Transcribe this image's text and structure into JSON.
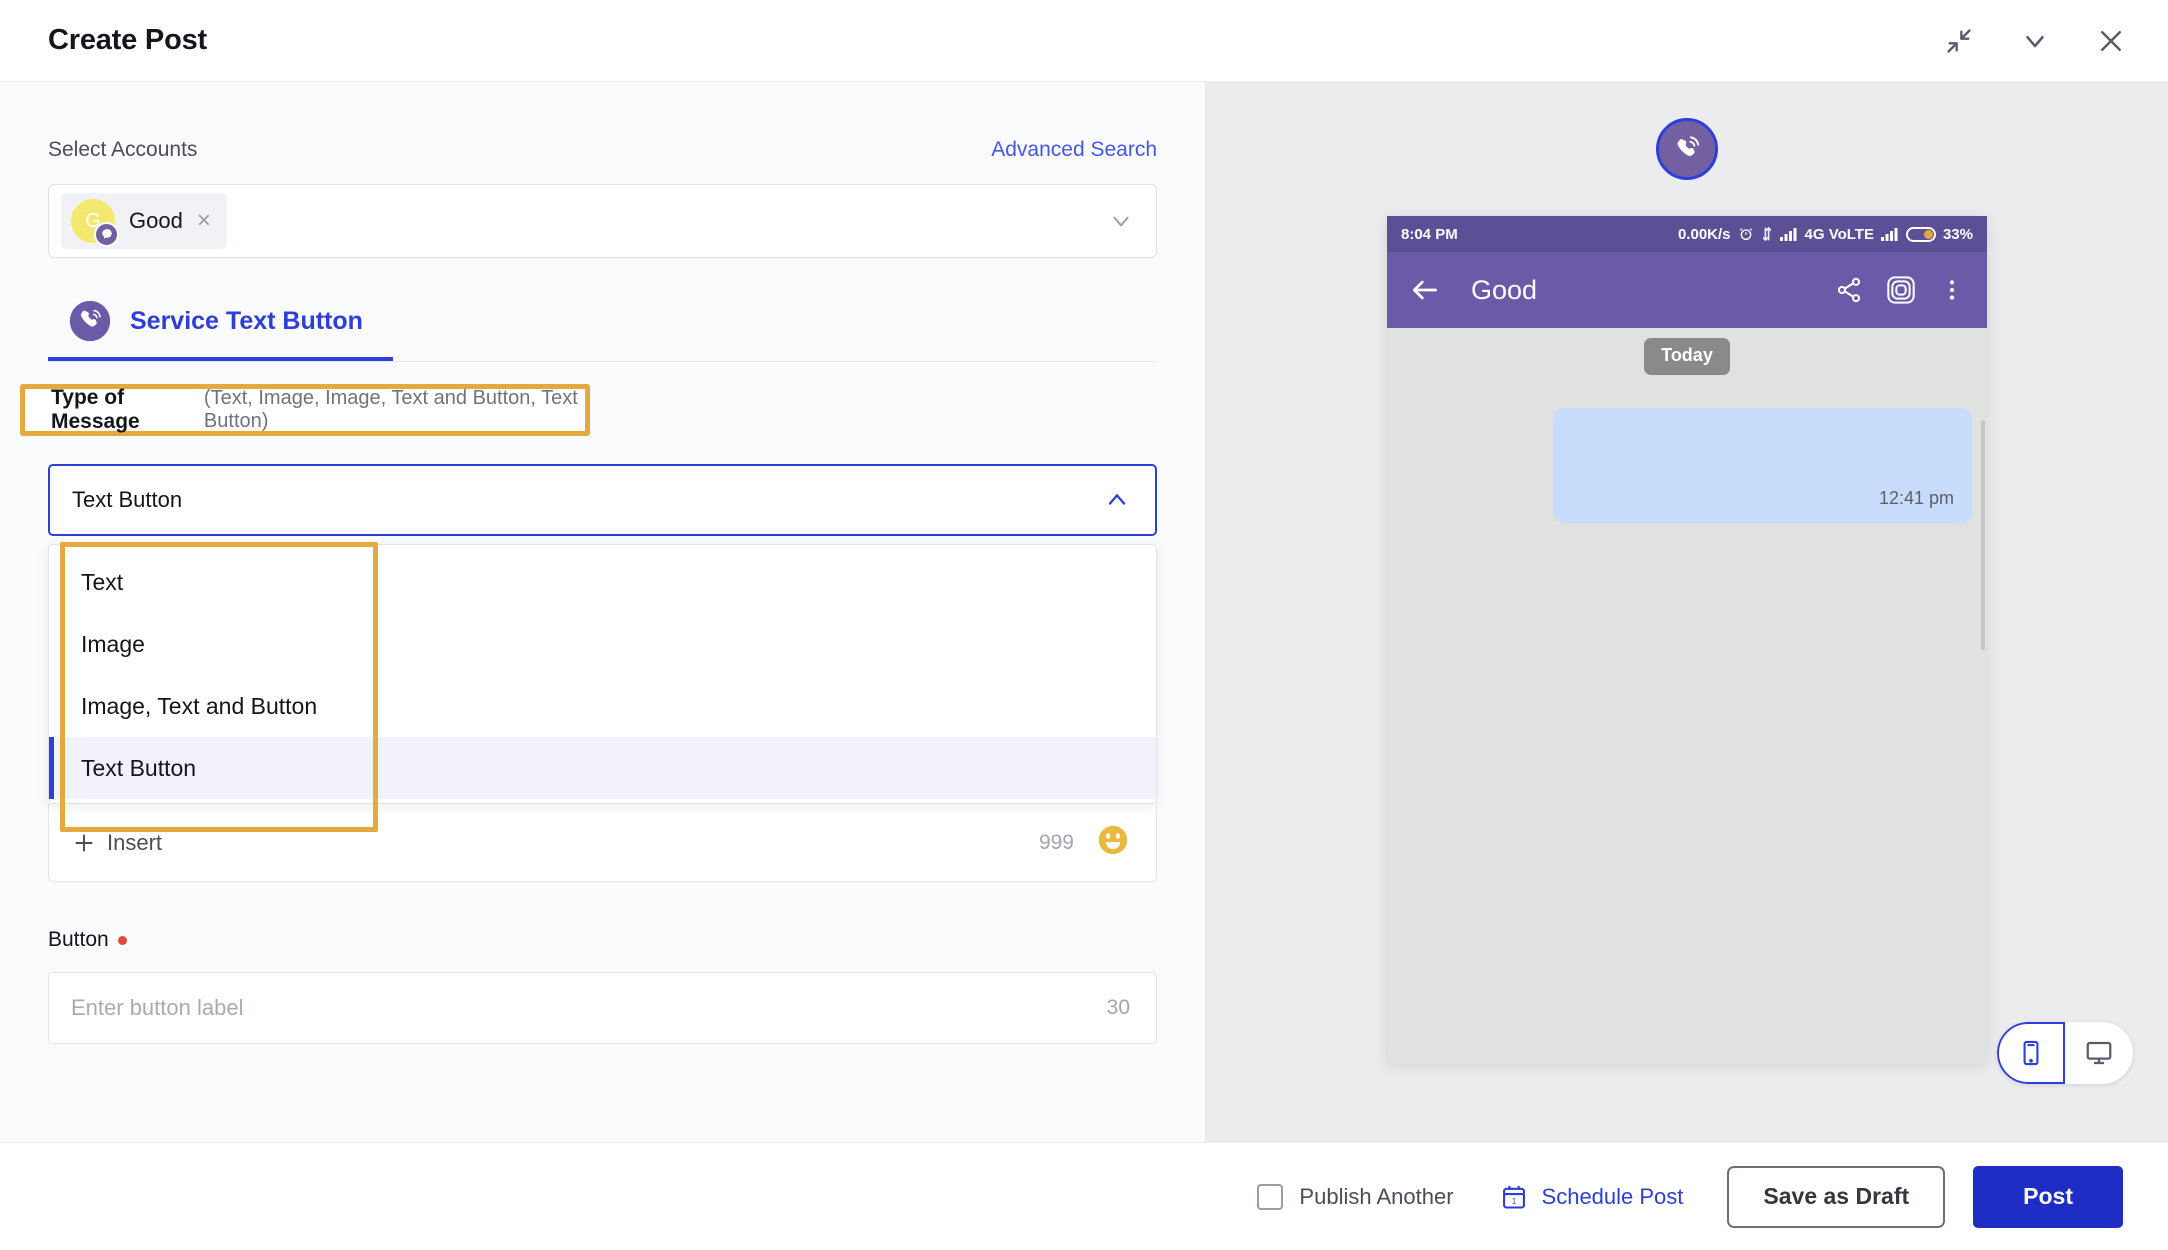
{
  "window": {
    "title": "Create Post",
    "actions": [
      {
        "name": "collapse-icon",
        "label": "Collapse"
      },
      {
        "name": "minimize-icon",
        "label": "Minimize"
      },
      {
        "name": "close-icon",
        "label": "Close"
      }
    ]
  },
  "accounts": {
    "label": "Select Accounts",
    "advanced_search": "Advanced Search",
    "selected_chip": {
      "initial": "G",
      "name": "Good",
      "remove": "×",
      "avatar_color": "#f4e86f",
      "badge_color": "#7360a0"
    }
  },
  "tab": {
    "label": "Service Text Button"
  },
  "type_of_message": {
    "label_strong": "Type of Message",
    "label_hint": "(Text, Image, Image, Text and Button, Text Button)",
    "selected_value": "Text Button",
    "options": [
      "Text",
      "Image",
      "Image, Text and Button",
      "Text Button"
    ],
    "selected_index": 3,
    "highlight_color": "#e5a93e"
  },
  "insert_bar": {
    "label": "Insert",
    "counter": "999",
    "emoji": "😃"
  },
  "button_field": {
    "label": "Button",
    "required": true,
    "placeholder": "Enter button label",
    "value": "",
    "counter": "30"
  },
  "preview": {
    "status_bar": {
      "time": "8:04 PM",
      "speed": "0.00K/s",
      "network": "4G VoLTE",
      "battery": "33%"
    },
    "app_bar": {
      "title": "Good"
    },
    "chat": {
      "day_divider": "Today",
      "message_time": "12:41 pm",
      "bubble_color": "#c8dcfb"
    },
    "device_toggle": {
      "mobile": "Mobile preview",
      "desktop": "Desktop preview",
      "active": "mobile"
    }
  },
  "footer": {
    "publish_another": "Publish Another",
    "schedule_post": "Schedule Post",
    "save_as_draft": "Save as Draft",
    "post": "Post",
    "primary_color": "#1e2ec4"
  }
}
